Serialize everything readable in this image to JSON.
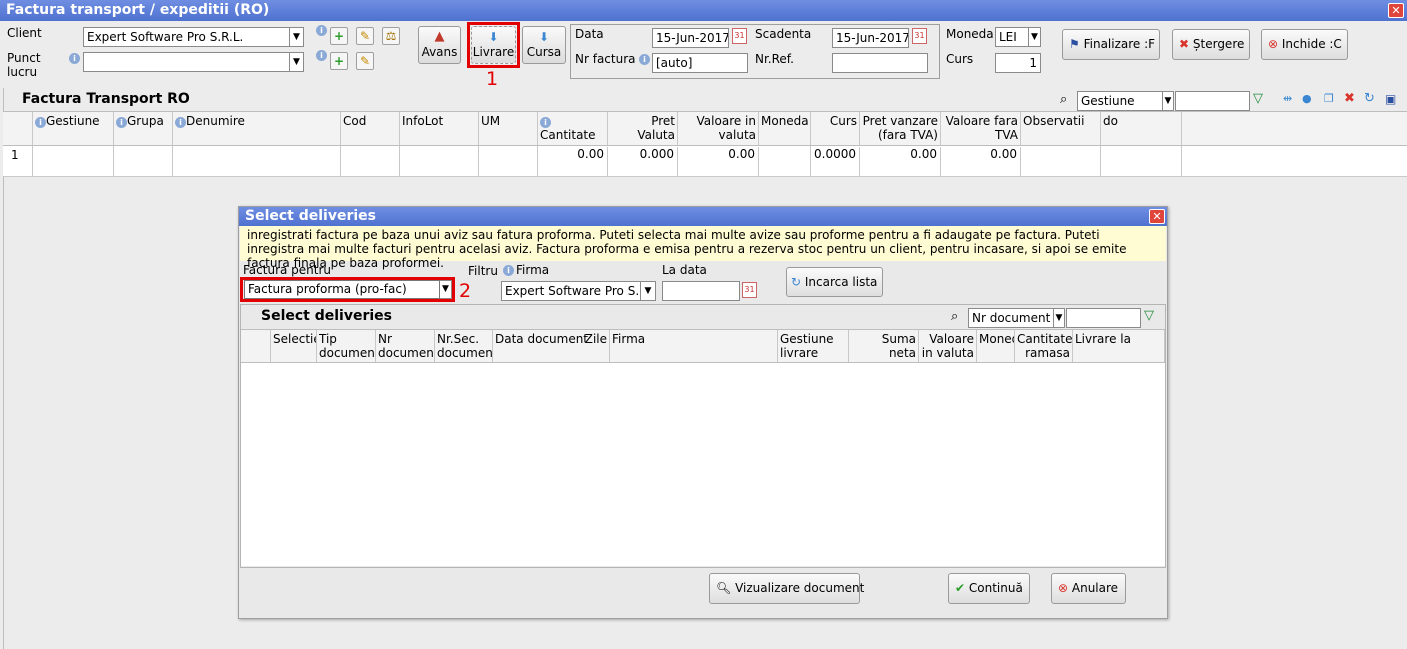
{
  "window": {
    "title": "Factura transport / expeditii (RO)"
  },
  "header": {
    "client_label": "Client",
    "client_value": "Expert Software Pro S.R.L.",
    "punct_label_1": "Punct",
    "punct_label_2": "lucru",
    "punct_value": "",
    "avans_label": "Avans",
    "livrare_label": "Livrare",
    "cursa_label": "Cursa",
    "data_label": "Data",
    "data_value": "15-Jun-2017",
    "scadenta_label": "Scadenta",
    "scadenta_value": "15-Jun-2017",
    "nrfactura_label": "Nr factura",
    "nrfactura_value": "[auto]",
    "nrref_label": "Nr.Ref.",
    "nrref_value": "",
    "moneda_label": "Moneda",
    "moneda_value": "LEI",
    "curs_label": "Curs",
    "curs_value": "1",
    "finalizare_label": "Finalizare :F",
    "stergere_label": "Ștergere",
    "inchide_label": "Inchide :C"
  },
  "annotations": {
    "one": "1",
    "two": "2"
  },
  "main_grid": {
    "title": "Factura Transport RO",
    "search_field": "Gestiune",
    "search_value": "",
    "columns": [
      "Gestiune",
      "Grupa",
      "Denumire",
      "Cod",
      "InfoLot",
      "UM",
      "Cantitate",
      "Pret Valuta",
      "Valoare in valuta",
      "Moneda",
      "Curs",
      "Pret vanzare (fara TVA)",
      "Valoare fara TVA",
      "Observatii",
      "do"
    ],
    "row": {
      "index": "1",
      "cantitate": "0.00",
      "pret_valuta": "0.000",
      "valoare_valuta": "0.00",
      "curs": "0.0000",
      "pret_vanzare": "0.00",
      "valoare_fara_tva": "0.00"
    }
  },
  "dialog": {
    "title": "Select deliveries",
    "info": "inregistrati factura pe baza unui aviz sau fatura proforma. Puteti selecta mai multe avize sau proforme pentru a fi adaugate pe factura. Puteti inregistra mai multe facturi pentru acelasi aviz. Factura proforma e emisa pentru a rezerva stoc pentru un client, pentru incasare, si apoi se emite factura finala pe baza proformei.",
    "factura_pentru_label": "Factura pentru",
    "factura_pentru_value": "Factura proforma (pro-fac)",
    "filtru_label": "Filtru",
    "firma_label": "Firma",
    "firma_value": "Expert Software Pro S.R.",
    "ladata_label": "La data",
    "ladata_value": "",
    "incarca_label": "Incarca lista",
    "grid_title": "Select deliveries",
    "search_field": "Nr document",
    "search_value": "",
    "columns": [
      "Selectie",
      "Tip document",
      "Nr document",
      "Nr.Sec. document",
      "Data document",
      "Zile",
      "Firma",
      "Gestiune livrare",
      "Suma neta",
      "Valoare in valuta",
      "Moneda",
      "Cantitate ramasa",
      "Livrare la"
    ],
    "vizualizare_label": "Vizualizare document",
    "continua_label": "Continuă",
    "anulare_label": "Anulare"
  }
}
